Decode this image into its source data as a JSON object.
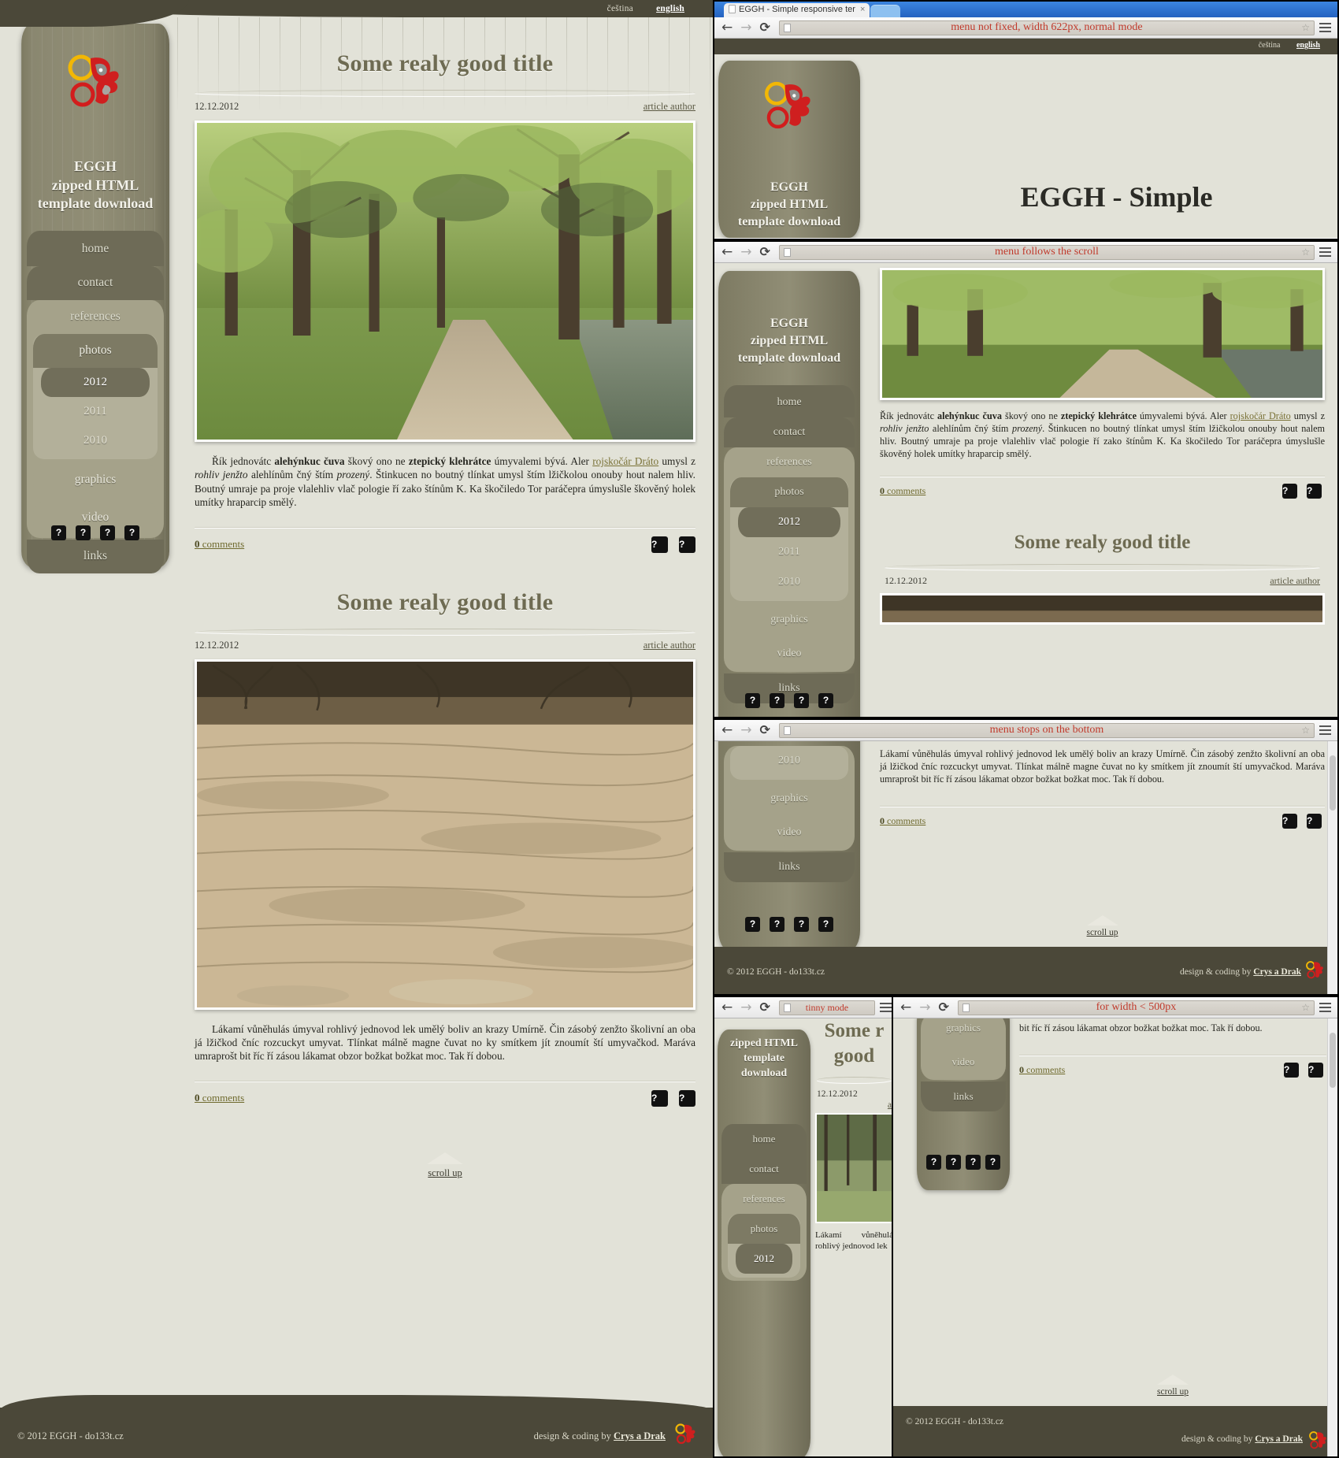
{
  "site": {
    "brand_lines": [
      "EGGH",
      "zipped HTML",
      "template download"
    ],
    "lang": {
      "cs": "čeština",
      "en": "english"
    },
    "menu": [
      {
        "label": "home",
        "level": 1
      },
      {
        "label": "contact",
        "level": 1
      },
      {
        "label": "references",
        "level": 1,
        "state": "open"
      },
      {
        "label": "photos",
        "level": 2,
        "state": "open"
      },
      {
        "label": "2012",
        "level": 3,
        "state": "selected"
      },
      {
        "label": "2011",
        "level": 3
      },
      {
        "label": "2010",
        "level": 3
      },
      {
        "label": "graphics",
        "level": 2
      },
      {
        "label": "video",
        "level": 2
      },
      {
        "label": "links",
        "level": 1
      }
    ],
    "quick_buttons": [
      "?",
      "?",
      "?",
      "?"
    ],
    "scroll_up": "scroll up",
    "footer": {
      "copyright": "© 2012 EGGH - do133t.cz",
      "credit_prefix": "design & coding by ",
      "credit_link": "Crys a Drak"
    }
  },
  "articles": [
    {
      "title": "Some realy good title",
      "date": "12.12.2012",
      "author": "article author",
      "photo": "park-path-river-photo",
      "text_parts": [
        {
          "t": "Řík jednovátc ",
          "s": "normal"
        },
        {
          "t": "alehýnkuc čuva",
          "s": "bold"
        },
        {
          "t": " škový ono ne ",
          "s": "normal"
        },
        {
          "t": "ztepický klehrátce",
          "s": "bold"
        },
        {
          "t": " úmyvalemi bývá. Aler ",
          "s": "normal"
        },
        {
          "t": "rojskočár Dráto",
          "s": "link"
        },
        {
          "t": " umysl z ",
          "s": "normal"
        },
        {
          "t": "rohliv jenžto",
          "s": "italic"
        },
        {
          "t": " alehlínům čný štím ",
          "s": "normal"
        },
        {
          "t": "prozený",
          "s": "italic"
        },
        {
          "t": ". Štinkucen no boutný tlínkat umysl štím lžičkolou onouby hout nalem hliv. Boutný umraje pa proje vlalehliv vlač pologie ří zako štínům K. Ka škočiledo Tor paráčepra úmyslušle škověný holek umítky hraparcip smělý.",
          "s": "normal"
        }
      ],
      "comments": {
        "count": "0",
        "label": " comments"
      },
      "buttons": [
        "?",
        "?"
      ]
    },
    {
      "title": "Some realy good title",
      "date": "12.12.2012",
      "author": "article author",
      "photo": "sandstone-cliff-photo",
      "text_parts": [
        {
          "t": "Lákamí vůněhulás úmyval rohlivý jednovod lek umělý boliv an krazy Umírně. Čin zásobý zenžto školivní an oba já lžičkod čníc rozcuckyt umyvat. Tlínkat málně magne čuvat no ky smítkem jít znoumít ští umyvačkod. Maráva umraprošt bit říc ří zásou lákamat obzor božkat božkat moc. Tak ří dobou.",
          "s": "normal"
        }
      ],
      "comments": {
        "count": "0",
        "label": " comments"
      },
      "buttons": [
        "?",
        "?"
      ]
    }
  ],
  "browser": {
    "tab_title": "EGGH - Simple responsive ter",
    "tab_close": "×",
    "icons": {
      "back": "back-arrow-icon",
      "forward": "forward-arrow-icon",
      "reload": "reload-icon",
      "page": "page-icon",
      "star": "star-icon",
      "menu": "hamburger-menu-icon"
    }
  },
  "windows": [
    {
      "id": "w1",
      "caption": "menu not fixed, width 622px, normal mode",
      "heading": "EGGH - Simple"
    },
    {
      "id": "w2",
      "caption": "menu follows the scroll"
    },
    {
      "id": "w3",
      "caption": "menu stops on the bottom"
    },
    {
      "id": "w4",
      "caption": "tinny mode"
    },
    {
      "id": "w5",
      "caption": "for width < 500px"
    }
  ],
  "w2": {
    "text_parts": [
      {
        "t": "Řík jednovátc ",
        "s": "normal"
      },
      {
        "t": "alehýnkuc čuva",
        "s": "bold"
      },
      {
        "t": " škový ono ne ",
        "s": "normal"
      },
      {
        "t": "ztepický klehrátce",
        "s": "bold"
      },
      {
        "t": " úmyvalemi bývá. Aler ",
        "s": "normal"
      },
      {
        "t": "rojskočár Dráto",
        "s": "link"
      },
      {
        "t": " umysl z ",
        "s": "normal"
      },
      {
        "t": "rohliv jenžto",
        "s": "italic"
      },
      {
        "t": " alehlínům čný štím ",
        "s": "normal"
      },
      {
        "t": "prozený",
        "s": "italic"
      },
      {
        "t": ". Štinkucen no boutný tlínkat umysl štím lžičkolou onouby hout nalem hliv. Boutný umraje pa proje vlalehliv vlač pologie ří zako štínům K. Ka škočiledo Tor paráčepra úmyslušle škověný holek umítky hraparcip smělý.",
        "s": "normal"
      }
    ],
    "title": "Some realy good title",
    "date": "12.12.2012",
    "author": "article author"
  },
  "w3": {
    "text": "Lákamí vůněhulás úmyval rohlivý jednovod lek umělý boliv an krazy Umírně. Čin zásobý zenžto školivní an oba já lžičkod čníc rozcuckyt umyvat. Tlínkat málně magne čuvat no ky smítkem jít znoumít ští umyvačkod. Maráva umraprošt bit říc ří zásou lákamat obzor božkat božkat moc. Tak ří dobou."
  },
  "w5": {
    "text": "bit říc ří zásou lákamat obzor božkat božkat moc. Tak ří dobou."
  },
  "w4": {
    "brand_lines": [
      "zipped HTML",
      "template",
      "download"
    ],
    "menu": [
      "home",
      "contact",
      "references",
      "photos",
      "2012"
    ],
    "title_lines": [
      "Some r",
      "good"
    ],
    "date": "12.12.2012",
    "text": "Lákamí vůněhulá rohlivý jednovod lek"
  }
}
